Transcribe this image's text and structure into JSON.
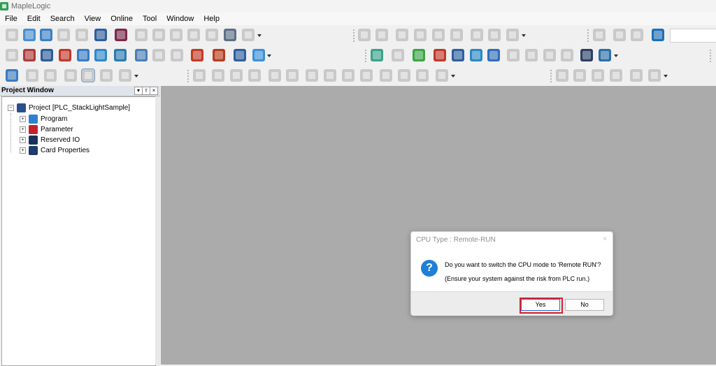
{
  "app": {
    "title": "MapleLogic",
    "icon": "maplelogic-app-icon"
  },
  "menu": [
    "File",
    "Edit",
    "Search",
    "View",
    "Online",
    "Tool",
    "Window",
    "Help"
  ],
  "project_window": {
    "title": "Project Window",
    "root": "Project [PLC_StackLightSample]",
    "children": [
      "Program",
      "Parameter",
      "Reserved IO",
      "Card Properties"
    ]
  },
  "dialog": {
    "title": "CPU Type : Remote-RUN",
    "close_glyph": "×",
    "message": "Do you want to switch the CPU mode to 'Remote RUN'?",
    "note": "(Ensure your system against the risk from PLC run.)",
    "yes_label": "Yes",
    "no_label": "No"
  },
  "colors": {
    "workspace": "#ababab",
    "highlight": "#d3202a",
    "question_icon": "#1e7fd6"
  }
}
